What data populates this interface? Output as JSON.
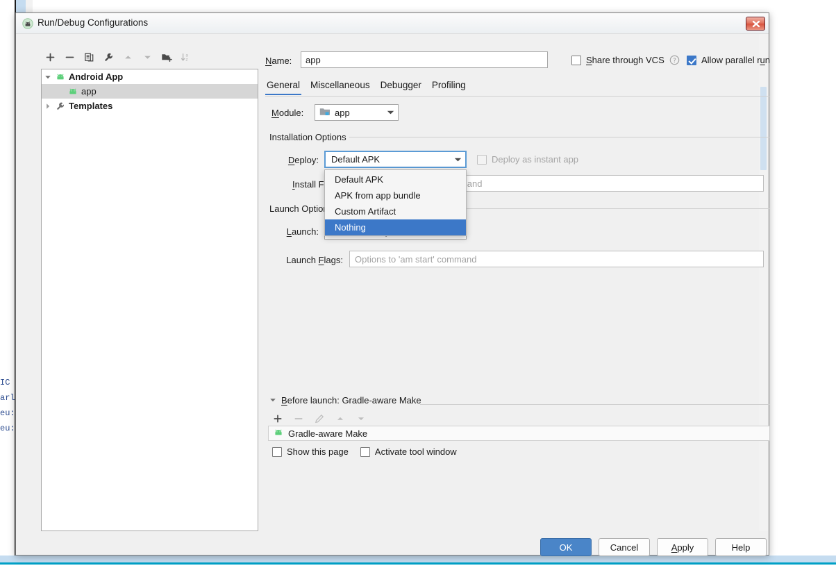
{
  "background": {
    "code_lines": [
      "IC",
      "arl",
      "eu:",
      "eu:"
    ]
  },
  "window": {
    "title": "Run/Debug Configurations",
    "app_icon": "android-studio-icon",
    "close_label": "×"
  },
  "toolbar": {
    "buttons": [
      {
        "name": "add-configuration-button",
        "icon": "plus-icon",
        "enabled": true
      },
      {
        "name": "remove-configuration-button",
        "icon": "minus-icon",
        "enabled": true
      },
      {
        "name": "copy-configuration-button",
        "icon": "copy-icon",
        "enabled": true
      },
      {
        "name": "edit-templates-button",
        "icon": "wrench-icon",
        "enabled": true
      },
      {
        "name": "move-up-button",
        "icon": "arrow-up-icon",
        "enabled": false
      },
      {
        "name": "move-down-button",
        "icon": "arrow-down-icon",
        "enabled": false
      },
      {
        "name": "move-into-folder-button",
        "icon": "folder-add-icon",
        "enabled": true
      },
      {
        "name": "sort-configurations-button",
        "icon": "sort-alpha-icon",
        "enabled": false
      }
    ]
  },
  "tree": {
    "items": [
      {
        "label": "Android App",
        "icon": "android-icon",
        "expanded": true,
        "bold": true,
        "level": 0,
        "selected": false
      },
      {
        "label": "app",
        "icon": "android-icon",
        "expanded": null,
        "bold": false,
        "level": 1,
        "selected": true
      },
      {
        "label": "Templates",
        "icon": "wrench-icon",
        "expanded": false,
        "bold": true,
        "level": 0,
        "selected": false
      }
    ]
  },
  "form": {
    "name_label": "Name:",
    "name_mnemonic": "N",
    "name_value": "app",
    "share_vcs_label": "Share through VCS",
    "share_vcs_mnemonic": "S",
    "share_vcs_checked": false,
    "help_icon": "question-circle-icon",
    "allow_parallel_label": "Allow parallel run",
    "allow_parallel_checked": true,
    "accent_color": "#3c78c8"
  },
  "tabs": [
    {
      "label": "General",
      "active": true
    },
    {
      "label": "Miscellaneous",
      "active": false
    },
    {
      "label": "Debugger",
      "active": false
    },
    {
      "label": "Profiling",
      "active": false
    }
  ],
  "general": {
    "module_label": "Module:",
    "module_mnemonic": "M",
    "module_value": "app",
    "module_icon": "module-folder-icon",
    "installation_section": "Installation Options",
    "deploy_label": "Deploy:",
    "deploy_mnemonic": "D",
    "deploy_value": "Default APK",
    "instant_app_label": "Deploy as instant app",
    "instant_app_checked": false,
    "instant_app_enabled": false,
    "install_flags_label": "Install Flags:",
    "install_flags_value": "",
    "install_flags_placeholder": "Options to 'pm install' command",
    "launch_section": "Launch Options",
    "launch_label": "Launch:",
    "launch_value": "Default Activity",
    "launch_flags_label": "Launch Flags:",
    "launch_flags_value": "",
    "launch_flags_placeholder": "Options to 'am start' command"
  },
  "deploy_dropdown": {
    "open": true,
    "options": [
      {
        "label": "Default APK",
        "selected": false
      },
      {
        "label": "APK from app bundle",
        "selected": false
      },
      {
        "label": "Custom Artifact",
        "selected": false
      },
      {
        "label": "Nothing",
        "selected": true
      }
    ]
  },
  "before_launch": {
    "header": "Before launch: Gradle-aware Make",
    "header_mnemonic": "B",
    "expanded": true,
    "toolbar": [
      {
        "name": "add-task-button",
        "icon": "plus-icon",
        "enabled": true
      },
      {
        "name": "remove-task-button",
        "icon": "minus-icon",
        "enabled": false
      },
      {
        "name": "edit-task-button",
        "icon": "pencil-icon",
        "enabled": false
      },
      {
        "name": "task-move-up-button",
        "icon": "arrow-up-icon",
        "enabled": false
      },
      {
        "name": "task-move-down-button",
        "icon": "arrow-down-icon",
        "enabled": false
      }
    ],
    "tasks": [
      {
        "label": "Gradle-aware Make",
        "icon": "android-icon"
      }
    ],
    "show_page_label": "Show this page",
    "show_page_checked": false,
    "activate_tool_window_label": "Activate tool window",
    "activate_tool_window_checked": false
  },
  "buttons": {
    "ok": "OK",
    "cancel": "Cancel",
    "apply": "Apply",
    "apply_mnemonic": "A",
    "help": "Help"
  }
}
